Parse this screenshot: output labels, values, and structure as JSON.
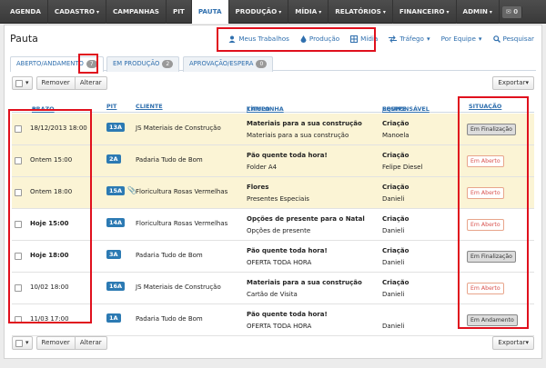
{
  "nav": {
    "items": [
      {
        "label": "AGENDA",
        "caret": false
      },
      {
        "label": "CADASTRO",
        "caret": true
      },
      {
        "label": "CAMPANHAS",
        "caret": false
      },
      {
        "label": "PIT",
        "caret": false
      },
      {
        "label": "PAUTA",
        "caret": false,
        "active": true
      },
      {
        "label": "PRODUÇÃO",
        "caret": true
      },
      {
        "label": "MÍDIA",
        "caret": true
      },
      {
        "label": "RELATÓRIOS",
        "caret": true
      },
      {
        "label": "FINANCEIRO",
        "caret": true
      },
      {
        "label": "ADMIN",
        "caret": true
      }
    ],
    "mail_count": "0"
  },
  "page": {
    "title": "Pauta"
  },
  "toolbar": {
    "meus_trabalhos": "Meus Trabalhos",
    "producao": "Produção",
    "midia": "Mídia",
    "trafego": "Tráfego",
    "por_equipe": "Por Equipe",
    "pesquisar": "Pesquisar"
  },
  "tabs": [
    {
      "label": "ABERTO/ANDAMENTO",
      "count": "7",
      "active": true
    },
    {
      "label": "EM PRODUÇÃO",
      "count": "2"
    },
    {
      "label": "APROVAÇÃO/ESPERA",
      "count": "0"
    }
  ],
  "actions": {
    "remover": "Remover",
    "alterar": "Alterar",
    "exportar": "Exportar"
  },
  "columns": {
    "prazo": "PRAZO",
    "pit": "PIT",
    "cliente": "CLIENTE",
    "campanha": "CAMPANHA",
    "sep": "/",
    "titulo": "TÍTULO",
    "equipe": "EQUIPE",
    "responsavel": "RESPONSÁVEL",
    "situacao": "SITUAÇÃO"
  },
  "rows": [
    {
      "prazo": "18/12/2013 18:00",
      "pit": "13A",
      "cliente": "JS Materiais de Construção",
      "campanha": "Materiais para a sua construção",
      "titulo": "Materiais para a sua construção",
      "equipe": "Criação",
      "responsavel": "Manoela",
      "situacao": "Em Finalização",
      "status": "fin",
      "highlight": true
    },
    {
      "prazo": "Ontem 15:00",
      "pit": "2A",
      "cliente": "Padaria Tudo de Bom",
      "campanha": "Pão quente toda hora!",
      "titulo": "Folder A4",
      "equipe": "Criação",
      "responsavel": "Felipe Diesel",
      "situacao": "Em Aberto",
      "status": "ab",
      "highlight": true
    },
    {
      "prazo": "Ontem 18:00",
      "pit": "15A",
      "cliente": "Floricultura Rosas Vermelhas",
      "campanha": "Flores",
      "titulo": "Presentes Especiais",
      "equipe": "Criação",
      "responsavel": "Danieli",
      "situacao": "Em Aberto",
      "status": "ab",
      "highlight": true,
      "clip": true
    },
    {
      "prazo": "Hoje 15:00",
      "pit": "14A",
      "cliente": "Floricultura Rosas Vermelhas",
      "campanha": "Opções de presente para o Natal",
      "titulo": "Opções de presente",
      "equipe": "Criação",
      "responsavel": "Danieli",
      "situacao": "Em Aberto",
      "status": "ab",
      "bold": true
    },
    {
      "prazo": "Hoje 18:00",
      "pit": "3A",
      "cliente": "Padaria Tudo de Bom",
      "campanha": "Pão quente toda hora!",
      "titulo": "OFERTA TODA HORA",
      "equipe": "Criação",
      "responsavel": "Danieli",
      "situacao": "Em Finalização",
      "status": "fin",
      "bold": true
    },
    {
      "prazo": "10/02 18:00",
      "pit": "16A",
      "cliente": "JS Materiais de Construção",
      "campanha": "Materiais para a sua construção",
      "titulo": "Cartão de Visita",
      "equipe": "Criação",
      "responsavel": "Danieli",
      "situacao": "Em Aberto",
      "status": "ab"
    },
    {
      "prazo": "11/03 17:00",
      "pit": "1A",
      "cliente": "Padaria Tudo de Bom",
      "campanha": "Pão quente toda hora!",
      "titulo": "OFERTA TODA HORA",
      "equipe": "",
      "responsavel": "Danieli",
      "situacao": "Em Andamento",
      "status": "and"
    }
  ],
  "colors": {
    "accent": "#2f6fae",
    "highlight_box": "#e0101d",
    "row_yellow": "#fbf4d5",
    "pit_badge": "#2c7ab3"
  }
}
